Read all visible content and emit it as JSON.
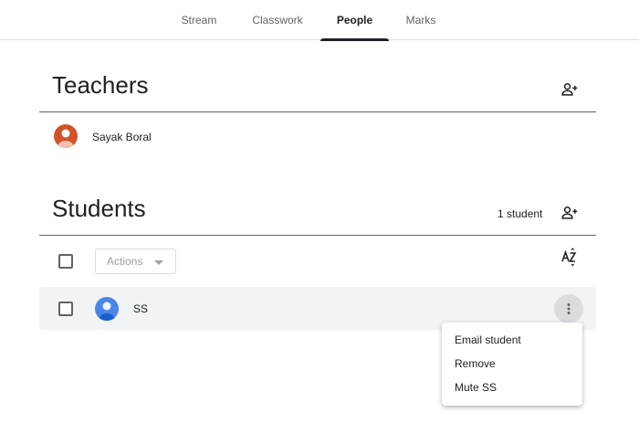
{
  "nav": {
    "tabs": [
      {
        "label": "Stream",
        "active": false
      },
      {
        "label": "Classwork",
        "active": false
      },
      {
        "label": "People",
        "active": true
      },
      {
        "label": "Marks",
        "active": false
      }
    ]
  },
  "teachers": {
    "title": "Teachers",
    "add_icon": "person-add-icon",
    "people": [
      {
        "name": "Sayak Boral",
        "avatar_color": "#d2522b"
      }
    ]
  },
  "students": {
    "title": "Students",
    "count": "1 student",
    "add_icon": "person-add-icon",
    "actions_label": "Actions",
    "sort_icon": "sort-az-icon",
    "people": [
      {
        "name": "SS",
        "avatar_color": "#4a86e8"
      }
    ]
  },
  "context_menu": {
    "items": [
      "Email student",
      "Remove",
      "Mute SS"
    ]
  },
  "colors": {
    "divider": "#5f6368",
    "row_highlight": "#f1f3f4",
    "text_secondary": "#5f6368"
  }
}
